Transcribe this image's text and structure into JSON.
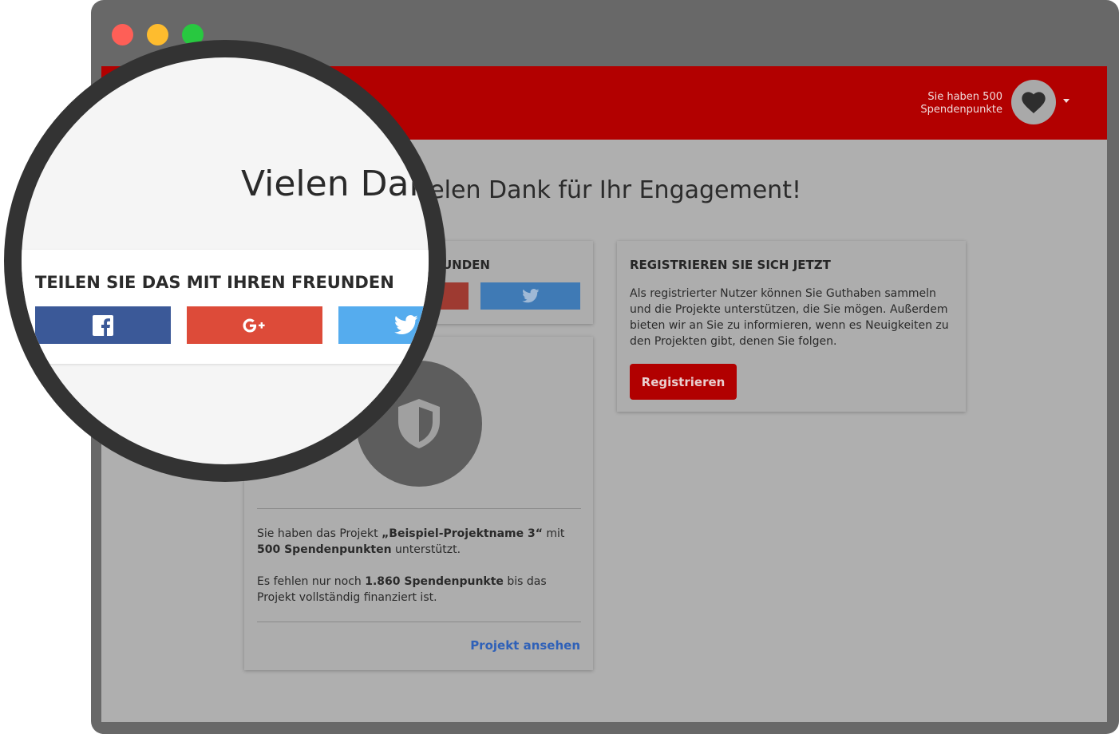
{
  "window": {
    "controls": [
      "close",
      "minimize",
      "maximize"
    ]
  },
  "header": {
    "points_line1": "Sie haben 500",
    "points_line2": "Spendenpunkte",
    "avatar_icon": "heart-icon",
    "menu_icon": "caret-down-icon"
  },
  "main": {
    "heading": "Vielen Dank für Ihr Engagement!",
    "heading_visible": "elen Dank für Ihr Engagement!"
  },
  "share": {
    "title": "TEILEN SIE DAS MIT IHREN FREUNDEN",
    "title_visible": "UNDEN",
    "buttons": [
      {
        "network": "Facebook",
        "icon": "facebook-icon",
        "color": "#3b5998"
      },
      {
        "network": "Google+",
        "icon": "google-plus-icon",
        "color": "#dd4b39"
      },
      {
        "network": "Twitter",
        "icon": "twitter-icon",
        "color": "#55acee"
      }
    ]
  },
  "project": {
    "icon": "shield-icon",
    "text1_prefix": "Sie haben das Projekt ",
    "project_name": "„Beispiel-Projektname 3“",
    "text1_mid": " mit ",
    "points": "500 Spendenpunkten",
    "text1_suffix": " unterstützt.",
    "text2_prefix": "Es fehlen nur noch ",
    "missing_points": "1.860 Spendenpunkte",
    "text2_suffix": " bis das Projekt vollständig finanziert ist.",
    "link_label": "Projekt ansehen"
  },
  "register": {
    "title": "REGISTRIEREN SIE SICH JETZT",
    "text": "Als registrierter Nutzer können Sie Guthaben sammeln und die Projekte unterstützen, die Sie mögen. Außerdem bieten wir an Sie zu informieren, wenn es Neuigkeiten zu den Projekten gibt, denen Sie folgen.",
    "button_label": "Registrieren"
  },
  "magnifier": {
    "heading_visible": "Vielen Dan",
    "share_title": "TEILEN SIE DAS MIT IHREN FREUNDEN"
  },
  "colors": {
    "brand_red": "#b20000",
    "link_blue": "#2f61b8",
    "facebook": "#3b5998",
    "google_plus": "#dd4b39",
    "twitter": "#55acee"
  }
}
